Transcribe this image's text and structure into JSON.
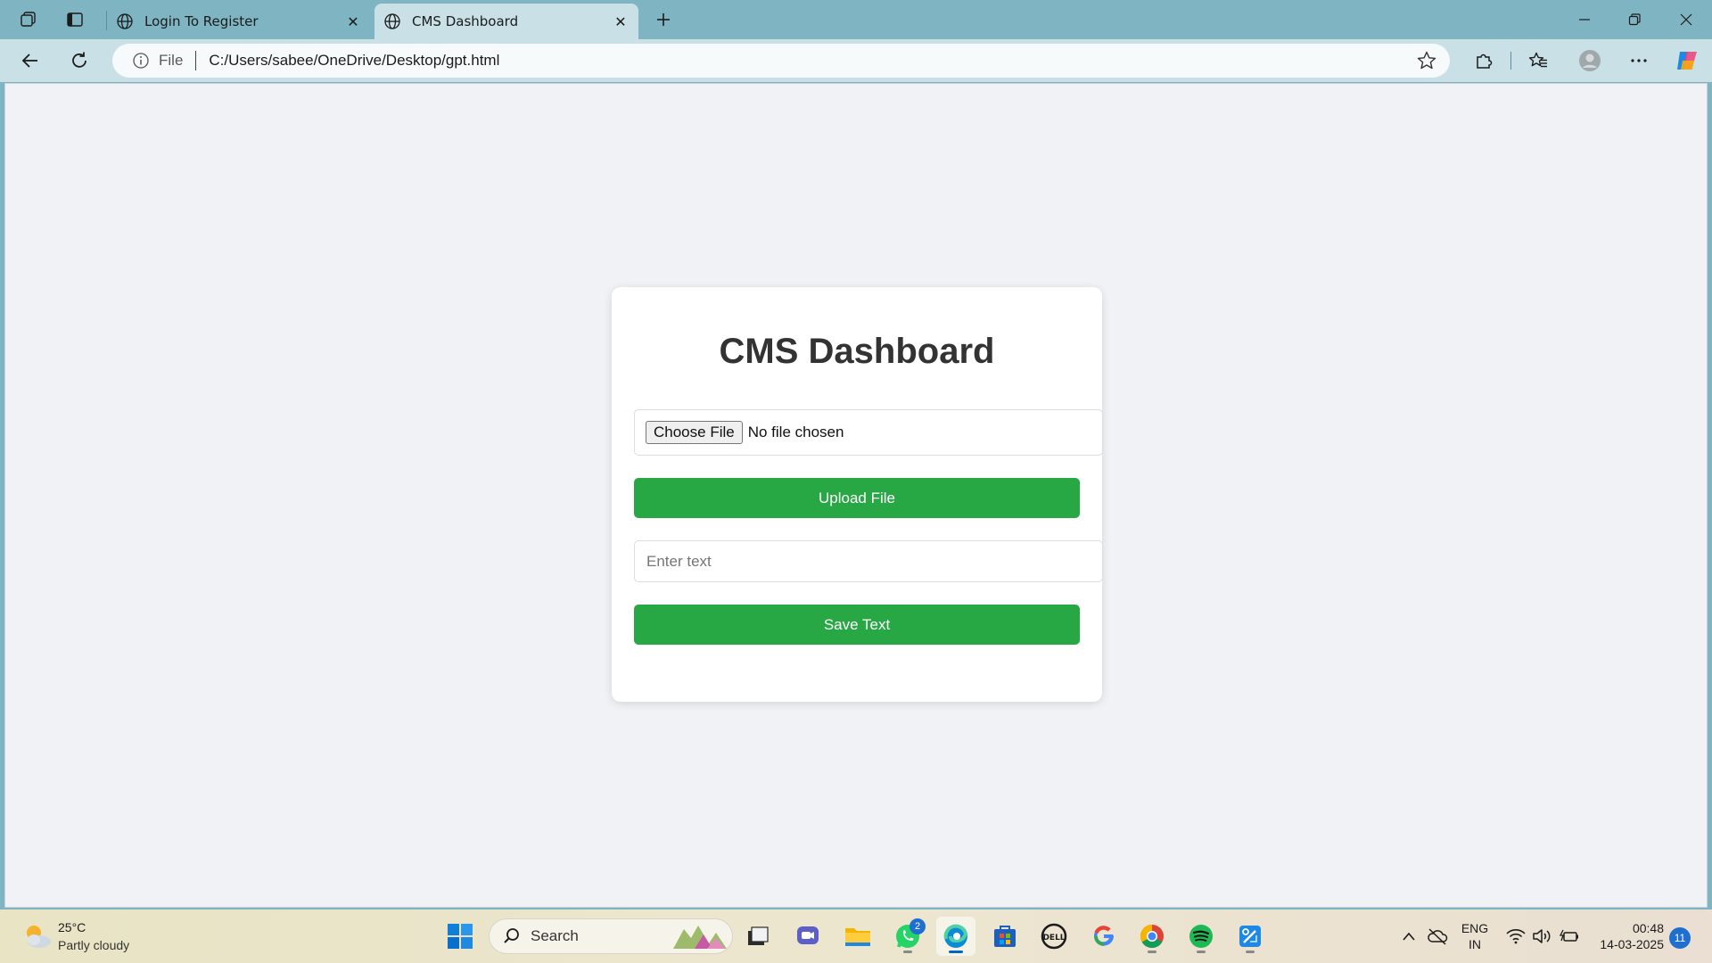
{
  "browser": {
    "tabs": [
      {
        "title": "Login To Register",
        "active": false
      },
      {
        "title": "CMS Dashboard",
        "active": true
      }
    ],
    "address": {
      "scheme_label": "File",
      "url": "C:/Users/sabee/OneDrive/Desktop/gpt.html"
    }
  },
  "page": {
    "title": "CMS Dashboard",
    "file_input": {
      "button_label": "Choose File",
      "status": "No file chosen"
    },
    "upload_button": "Upload File",
    "text_input": {
      "placeholder": "Enter text",
      "value": ""
    },
    "save_button": "Save Text"
  },
  "taskbar": {
    "weather": {
      "temp": "25°C",
      "condition": "Partly cloudy"
    },
    "search_label": "Search",
    "whatsapp_badge": "2",
    "language": {
      "line1": "ENG",
      "line2": "IN"
    },
    "clock": {
      "time": "00:48",
      "date": "14-03-2025"
    },
    "notifications": "11"
  },
  "colors": {
    "accent_green": "#28a745",
    "page_bg": "#f0f2f5",
    "titlebar": "#7fb5c2"
  }
}
